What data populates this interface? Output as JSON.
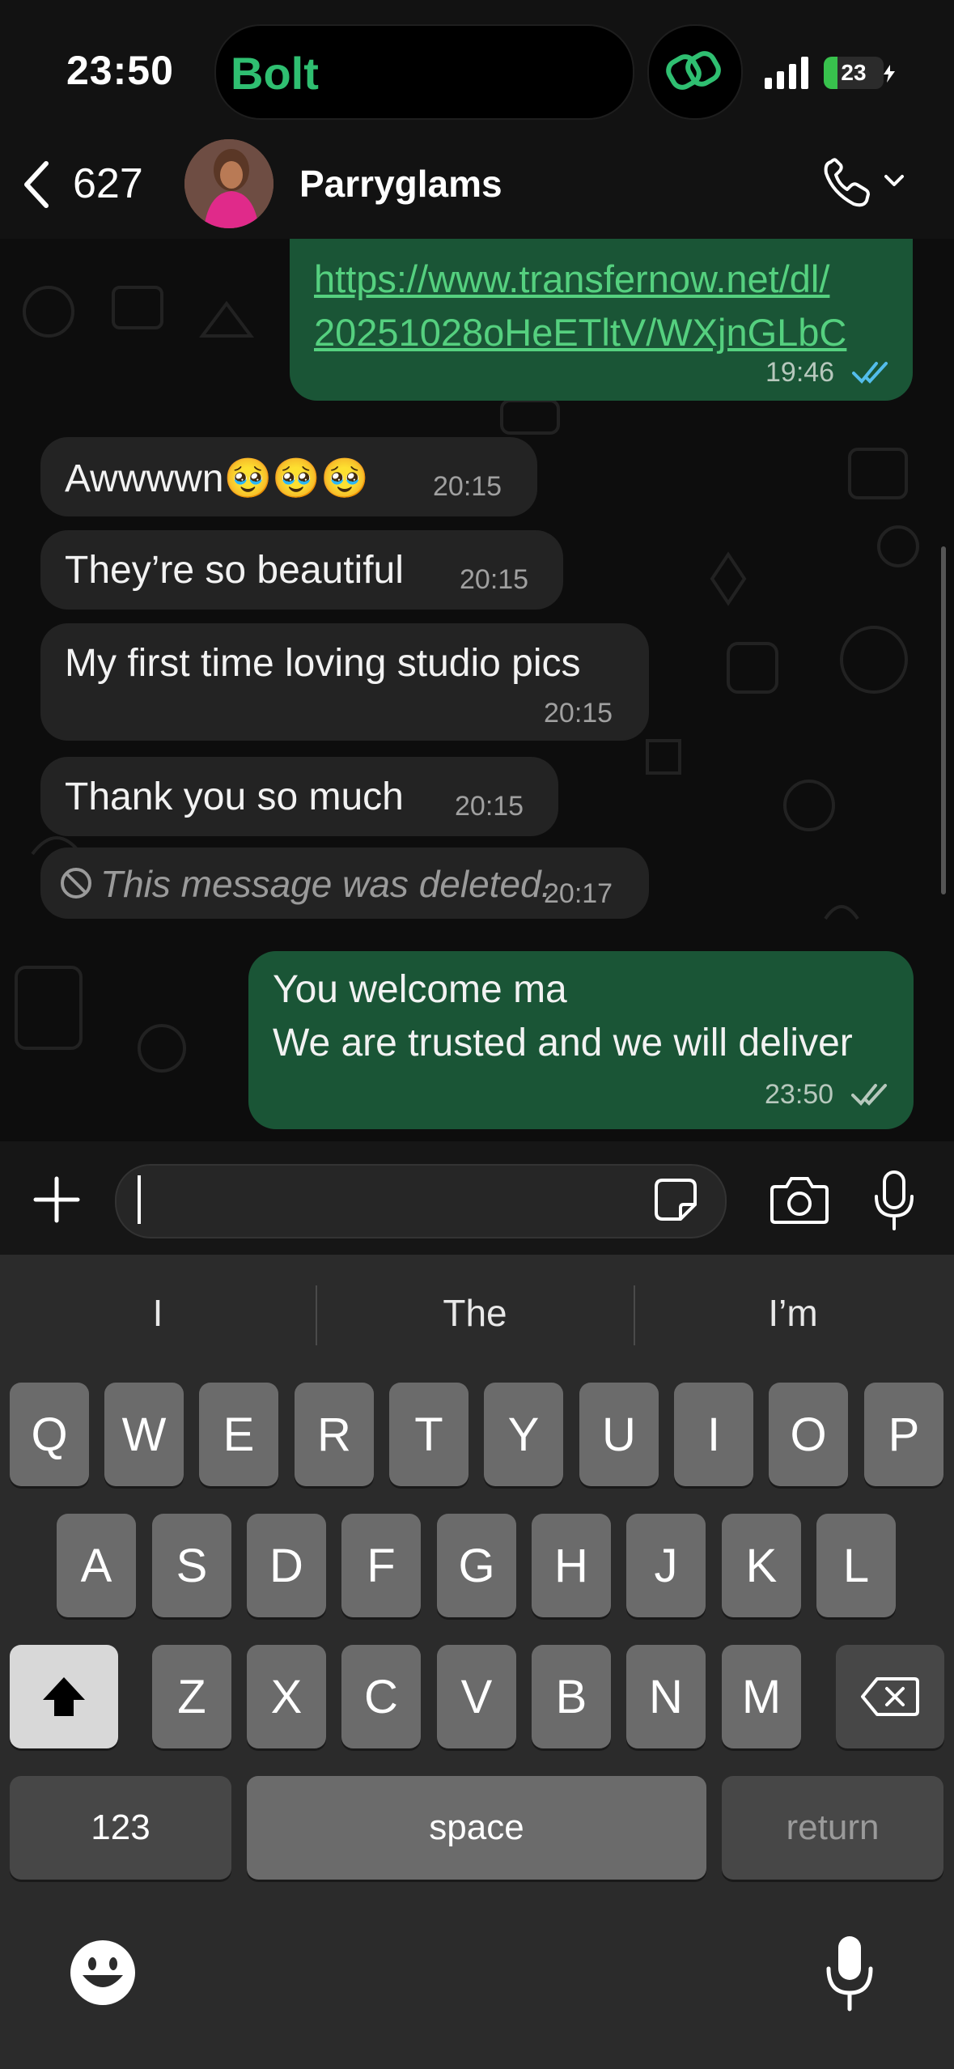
{
  "status_bar": {
    "time": "23:50",
    "app_pill": "Bolt",
    "battery": "23",
    "battery_level": 0.23
  },
  "header": {
    "back_count": "627",
    "contact_name": "Parryglams"
  },
  "messages": [
    {
      "dir": "out",
      "lines": [
        "https://www.transfernow.net/dl/",
        "20251028oHeETltV/WXjnGLbC"
      ],
      "time": "19:46",
      "status": "read"
    },
    {
      "dir": "in",
      "text": "Awwwwn🥹🥹🥹",
      "time": "20:15"
    },
    {
      "dir": "in",
      "text": "They’re so beautiful",
      "time": "20:15"
    },
    {
      "dir": "in",
      "text": "My first time loving studio pics",
      "time": "20:15"
    },
    {
      "dir": "in",
      "text": "Thank you so much",
      "time": "20:15"
    },
    {
      "dir": "in",
      "text": "This message was deleted.",
      "time": "20:17",
      "deleted": true
    },
    {
      "dir": "out",
      "lines": [
        "You welcome ma",
        "We are trusted and we will deliver"
      ],
      "time": "23:50",
      "status": "delivered"
    }
  ],
  "colors": {
    "incoming": "#232323",
    "outgoing": "#1a5536",
    "read_tick": "#53bdeb",
    "accent": "#2fbf71"
  },
  "keyboard": {
    "suggestions": [
      "I",
      "The",
      "I’m"
    ],
    "row1": [
      "Q",
      "W",
      "E",
      "R",
      "T",
      "Y",
      "U",
      "I",
      "O",
      "P"
    ],
    "row2": [
      "A",
      "S",
      "D",
      "F",
      "G",
      "H",
      "J",
      "K",
      "L"
    ],
    "row3": [
      "Z",
      "X",
      "C",
      "V",
      "B",
      "N",
      "M"
    ],
    "numbers": "123",
    "space": "space",
    "return": "return"
  }
}
